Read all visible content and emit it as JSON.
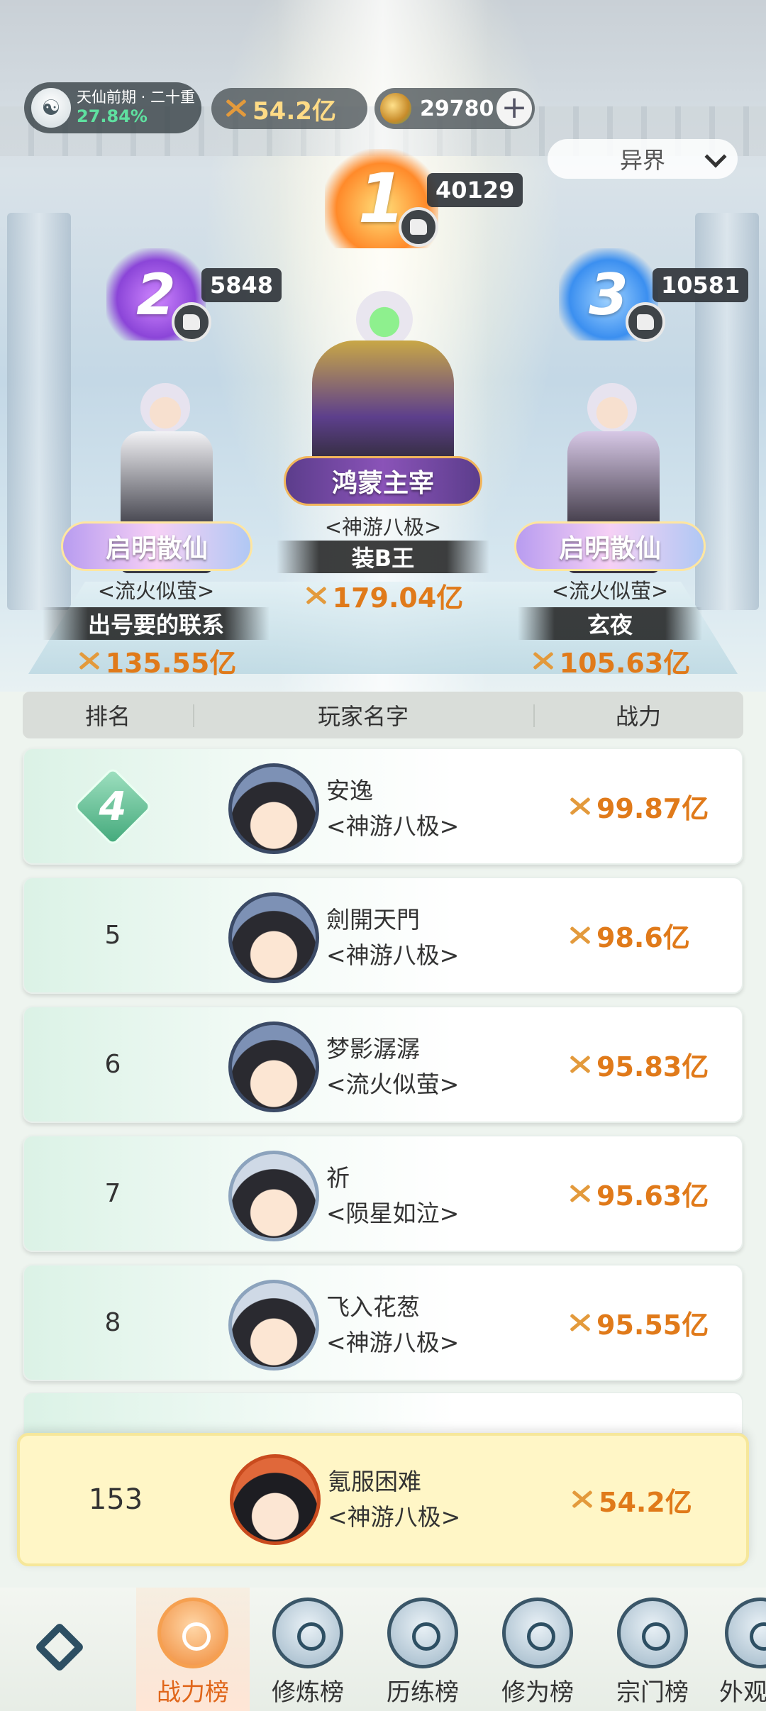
{
  "header": {
    "realm_name": "天仙前期 · 二十重",
    "realm_progress": "27.84%",
    "power_total": "54.2亿",
    "jade_count": "29780",
    "plus_label": "+",
    "region_select": "异界"
  },
  "podium": [
    {
      "rank": "1",
      "likes": "40129",
      "title": "鸿蒙主宰",
      "guild": "<神游八极>",
      "player": "装B王",
      "power": "179.04亿"
    },
    {
      "rank": "2",
      "likes": "5848",
      "title": "启明散仙",
      "guild": "<流火似萤>",
      "player": "出号要的联系",
      "power": "135.55亿"
    },
    {
      "rank": "3",
      "likes": "10581",
      "title": "启明散仙",
      "guild": "<流火似萤>",
      "player": "玄夜",
      "power": "105.63亿"
    }
  ],
  "table": {
    "col_rank": "排名",
    "col_name": "玩家名字",
    "col_power": "战力"
  },
  "rows": [
    {
      "rank": "4",
      "name": "安逸",
      "guild": "<神游八极>",
      "power": "99.87亿"
    },
    {
      "rank": "5",
      "name": "劍開天門",
      "guild": "<神游八极>",
      "power": "98.6亿"
    },
    {
      "rank": "6",
      "name": "梦影潺潺",
      "guild": "<流火似萤>",
      "power": "95.83亿"
    },
    {
      "rank": "7",
      "name": "祈",
      "guild": "<陨星如泣>",
      "power": "95.63亿"
    },
    {
      "rank": "8",
      "name": "飞入花葱",
      "guild": "<神游八极>",
      "power": "95.55亿"
    }
  ],
  "my_rank": {
    "rank": "153",
    "name": "氪服困难",
    "guild": "<神游八极>",
    "power": "54.2亿"
  },
  "nav": {
    "tabs": [
      "战力榜",
      "修炼榜",
      "历练榜",
      "修为榜",
      "宗门榜",
      "外观"
    ],
    "active": "战力榜"
  },
  "colors": {
    "power_orange": "#e07a1a",
    "progress_green": "#5fe0a0",
    "highlight_row": "#fff6c6"
  }
}
